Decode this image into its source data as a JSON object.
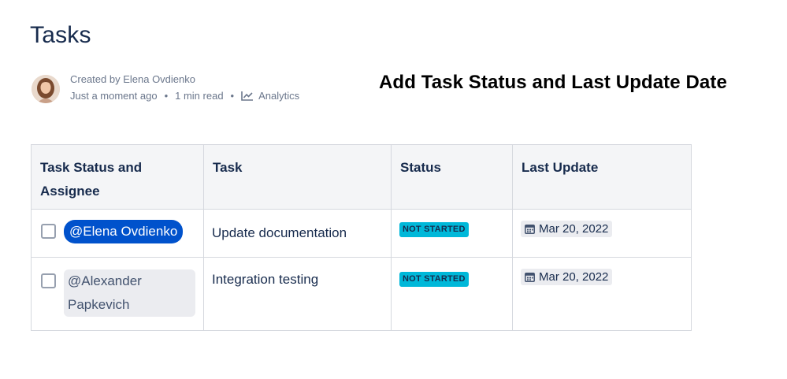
{
  "page": {
    "title": "Tasks"
  },
  "byline": {
    "created_by": "Created by Elena Ovdienko",
    "time": "Just a moment ago",
    "read_time": "1 min read",
    "analytics": "Analytics",
    "separator": "•",
    "avatar_icon": "user-avatar"
  },
  "caption": "Add Task Status and Last Update Date",
  "table": {
    "headers": [
      "Task Status and Assignee",
      "Task",
      "Status",
      "Last Update"
    ],
    "rows": [
      {
        "checked": false,
        "assignee": "@Elena Ovdienko",
        "assignee_is_self": true,
        "task": "Update documentation",
        "status": "NOT STARTED",
        "last_update": "Mar 20, 2022"
      },
      {
        "checked": false,
        "assignee": "@Alexander Papkevich",
        "assignee_is_self": false,
        "task": "Integration testing",
        "status": "NOT STARTED",
        "last_update": "Mar 20, 2022"
      }
    ]
  },
  "colors": {
    "mention_self": "#0052cc",
    "status_lozenge": "#00b8d9",
    "text_primary": "#172b4d",
    "text_subtle": "#6b778c"
  },
  "icons": [
    "analytics-chart-icon",
    "calendar-icon"
  ]
}
